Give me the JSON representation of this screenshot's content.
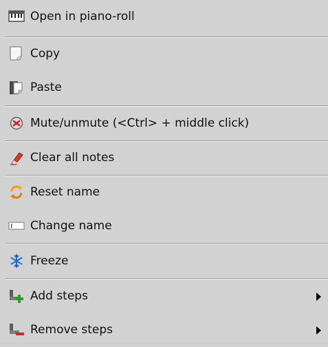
{
  "menu": {
    "items": [
      {
        "label": "Open in piano-roll",
        "icon": "piano-roll-icon"
      },
      {
        "label": "Copy",
        "icon": "copy-icon"
      },
      {
        "label": "Paste",
        "icon": "paste-icon"
      },
      {
        "label": "Mute/unmute (<Ctrl> + middle click)",
        "icon": "mute-icon"
      },
      {
        "label": "Clear all notes",
        "icon": "eraser-icon"
      },
      {
        "label": "Reset name",
        "icon": "reset-icon"
      },
      {
        "label": "Change name",
        "icon": "rename-icon"
      },
      {
        "label": "Freeze",
        "icon": "snowflake-icon"
      },
      {
        "label": "Add steps",
        "icon": "add-steps-icon",
        "submenu": true
      },
      {
        "label": "Remove steps",
        "icon": "remove-steps-icon",
        "submenu": true
      }
    ]
  },
  "colors": {
    "background": "#d2d2d2",
    "text": "#111111",
    "separator_dark": "#9a9a9a",
    "separator_light": "#f2f2f2"
  }
}
